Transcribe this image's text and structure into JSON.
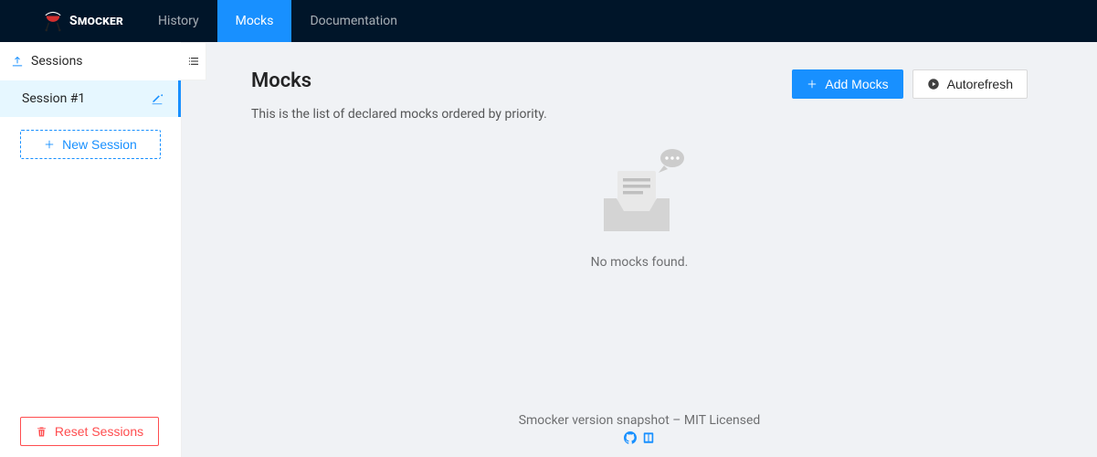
{
  "brand": {
    "name": "Smocker"
  },
  "nav": {
    "items": [
      {
        "label": "History",
        "active": false
      },
      {
        "label": "Mocks",
        "active": true
      },
      {
        "label": "Documentation",
        "active": false
      }
    ]
  },
  "sidebar": {
    "title": "Sessions",
    "sessions": [
      {
        "name": "Session #1"
      }
    ],
    "new_session_label": "New Session",
    "reset_label": "Reset Sessions"
  },
  "page": {
    "title": "Mocks",
    "description": "This is the list of declared mocks ordered by priority.",
    "add_mocks_label": "Add Mocks",
    "autorefresh_label": "Autorefresh",
    "empty_message": "No mocks found."
  },
  "footer": {
    "text": "Smocker version snapshot – MIT Licensed"
  }
}
